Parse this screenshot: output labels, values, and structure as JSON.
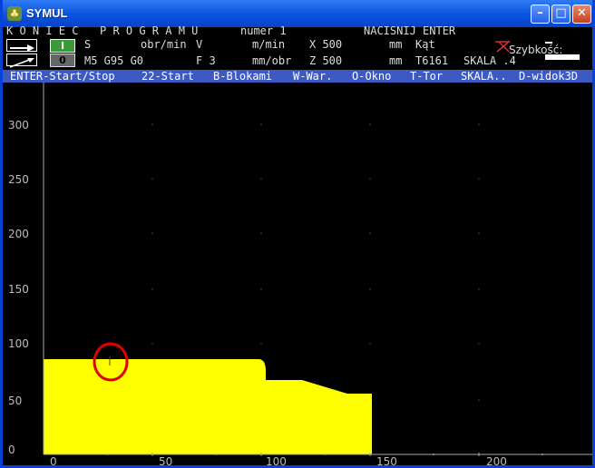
{
  "window": {
    "title": "SYMUL"
  },
  "info_row": {
    "koniec": "K O N I E C",
    "programu": "P R O G R A M U",
    "program_label": "numer 1",
    "prompt": "NACISNIJ ENTER"
  },
  "status": {
    "mode_top": "I",
    "mode_bottom": "0",
    "s_label": "S",
    "obr_min": "obr/min",
    "v_label": "V",
    "m_min": "m/min",
    "x_label": "X 500",
    "mm1": "mm",
    "kat": "Kąt",
    "codes": "M5 G95 G0",
    "f_label": "F 3",
    "mm_obr": "mm/obr",
    "z_label": "Z 500",
    "mm2": "mm",
    "tool": "T6161",
    "skala": "SKALA .4",
    "szybkosc": "Szybkość:"
  },
  "menu": [
    "ENTER-Start/Stop",
    "22-Start",
    "B-Blokami",
    "W-War.",
    "O-Okno",
    "T-Tor",
    "SKALA..",
    "D-widok3D"
  ],
  "plot": {
    "y_ticks": [
      "300",
      "250",
      "200",
      "150",
      "100",
      "50",
      "0"
    ],
    "x_ticks": [
      "0",
      "50",
      "100",
      "150",
      "200"
    ],
    "workpiece_color": "#ffff00",
    "marker_color": "#e00000"
  }
}
